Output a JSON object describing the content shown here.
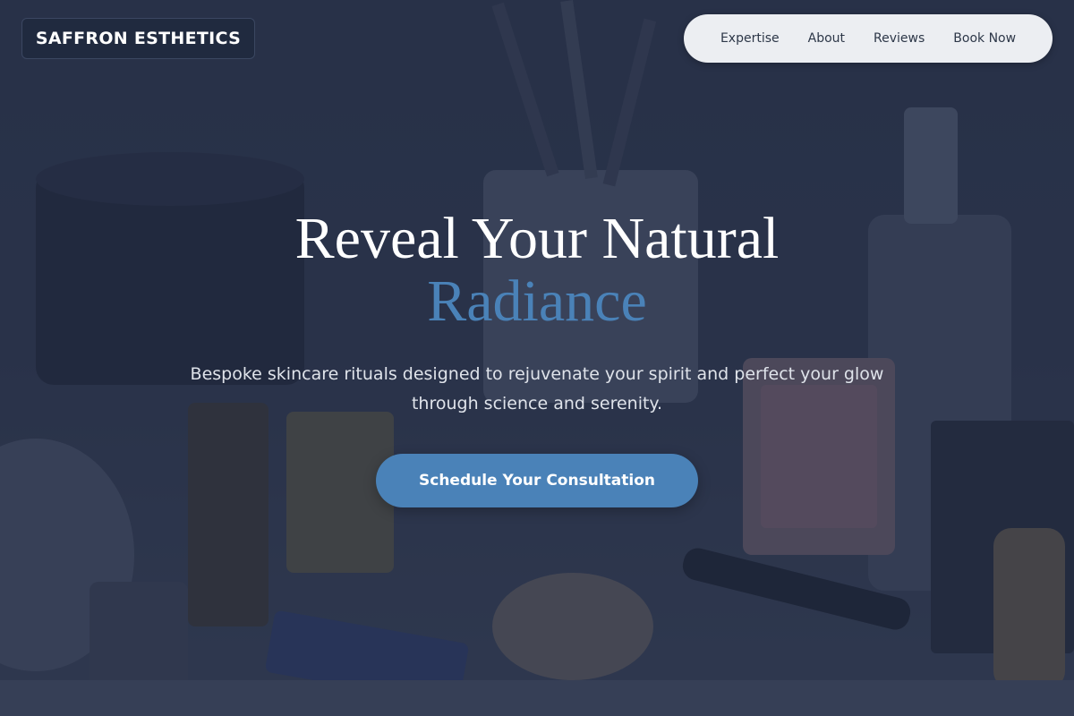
{
  "brand": {
    "name": "SAFFRON ESTHETICS"
  },
  "nav": {
    "items": [
      {
        "label": "Expertise"
      },
      {
        "label": "About"
      },
      {
        "label": "Reviews"
      },
      {
        "label": "Book Now"
      }
    ]
  },
  "hero": {
    "headline_line1": "Reveal Your Natural",
    "headline_line2": "Radiance",
    "subtitle": "Bespoke skincare rituals designed to rejuvenate your spirit and perfect your glow through science and serenity.",
    "cta_label": "Schedule Your Consultation"
  },
  "colors": {
    "accent": "#4a82b8",
    "overlay": "#263048",
    "nav_bg": "#eceef2",
    "text_light": "#ffffff"
  }
}
